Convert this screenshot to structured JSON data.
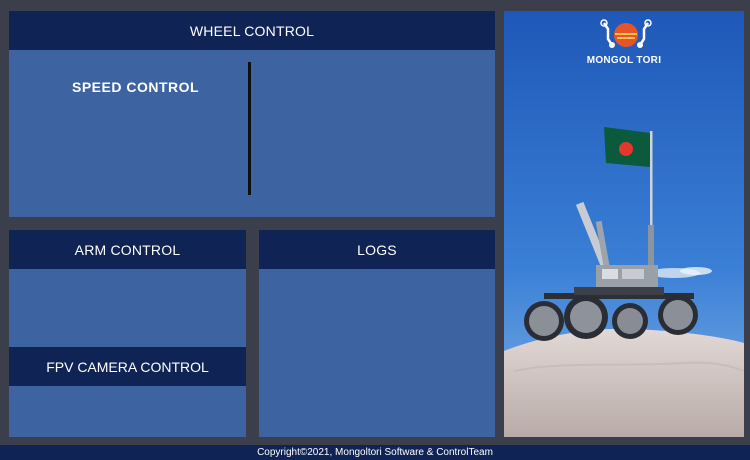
{
  "wheel": {
    "title": "WHEEL CONTROL",
    "speed_label": "SPEED CONTROL"
  },
  "arm": {
    "title": "ARM CONTROL"
  },
  "fpv": {
    "title": "FPV CAMERA CONTROL"
  },
  "logs": {
    "title": "LOGS"
  },
  "brand": {
    "name": "MONGOL TORI"
  },
  "footer": {
    "text": "Copyright©2021, Mongoltori Software & ControlTeam"
  },
  "colors": {
    "header": "#0f2355",
    "panel": "#3d64a0",
    "background": "#3a3f4b",
    "logo_sun": "#e8542a"
  }
}
